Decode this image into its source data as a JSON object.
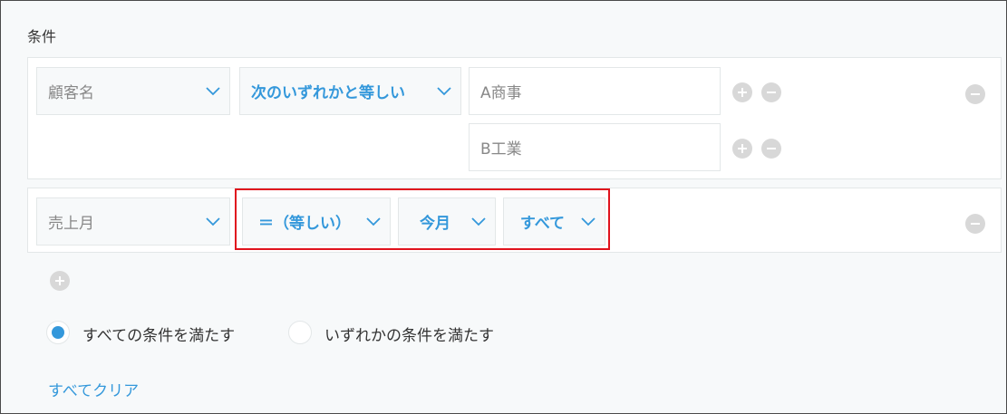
{
  "section_title": "条件",
  "conditions": [
    {
      "field": "顧客名",
      "operator": "次のいずれかと等しい",
      "values": [
        "A商事",
        "B工業"
      ]
    },
    {
      "field": "売上月",
      "operator": "＝（等しい）",
      "period": "今月",
      "scope": "すべて"
    }
  ],
  "match_options": {
    "all_label": "すべての条件を満たす",
    "any_label": "いずれかの条件を満たす",
    "selected": "all"
  },
  "clear_all_label": "すべてクリア",
  "colors": {
    "accent": "#3498db",
    "highlight": "#e0141e",
    "icon_gray": "#d8d8d8"
  }
}
